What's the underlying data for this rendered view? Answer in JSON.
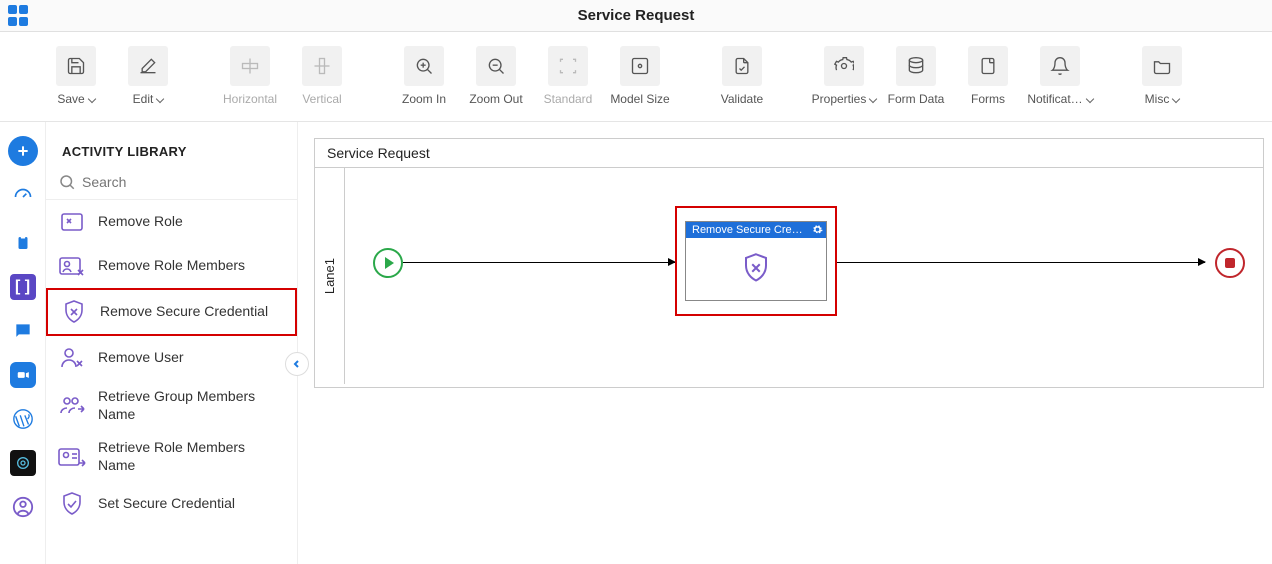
{
  "header": {
    "title": "Service Request"
  },
  "toolbar": {
    "save": {
      "label": "Save",
      "dropdown": true,
      "enabled": true
    },
    "edit": {
      "label": "Edit",
      "dropdown": true,
      "enabled": true
    },
    "horizontal": {
      "label": "Horizontal",
      "dropdown": false,
      "enabled": false
    },
    "vertical": {
      "label": "Vertical",
      "dropdown": false,
      "enabled": false
    },
    "zoomin": {
      "label": "Zoom In",
      "dropdown": false,
      "enabled": true
    },
    "zoomout": {
      "label": "Zoom Out",
      "dropdown": false,
      "enabled": true
    },
    "standard": {
      "label": "Standard",
      "dropdown": false,
      "enabled": false
    },
    "modelsize": {
      "label": "Model Size",
      "dropdown": false,
      "enabled": true
    },
    "validate": {
      "label": "Validate",
      "dropdown": false,
      "enabled": true
    },
    "properties": {
      "label": "Properties",
      "dropdown": true,
      "enabled": true
    },
    "formdata": {
      "label": "Form Data",
      "dropdown": false,
      "enabled": true
    },
    "forms": {
      "label": "Forms",
      "dropdown": false,
      "enabled": true
    },
    "notific": {
      "label": "Notificat…",
      "dropdown": true,
      "enabled": true
    },
    "misc": {
      "label": "Misc",
      "dropdown": true,
      "enabled": true
    }
  },
  "sidebar": {
    "title": "ACTIVITY LIBRARY",
    "search_placeholder": "Search",
    "items": [
      {
        "label": "Remove Role"
      },
      {
        "label": "Remove Role Members"
      },
      {
        "label": "Remove Secure Credential"
      },
      {
        "label": "Remove User"
      },
      {
        "label": "Retrieve Group Members Name"
      },
      {
        "label": "Retrieve Role Members Name"
      },
      {
        "label": "Set Secure Credential"
      }
    ]
  },
  "diagram": {
    "title": "Service Request",
    "lane_label": "Lane1",
    "activity_title": "Remove Secure Creden..."
  }
}
